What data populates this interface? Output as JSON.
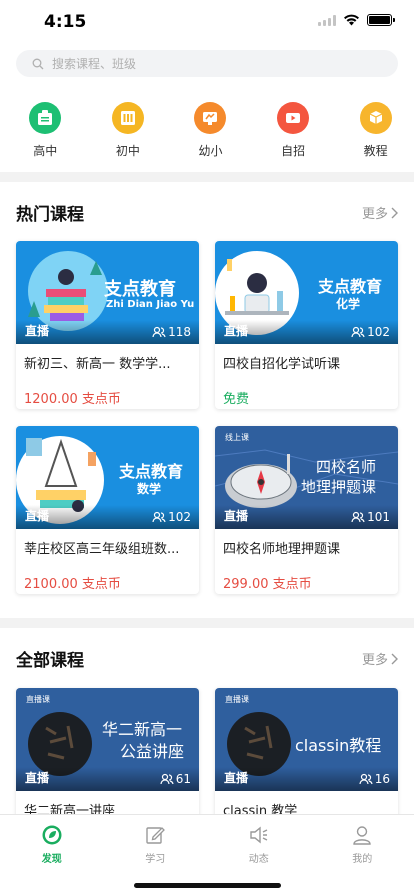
{
  "status": {
    "time": "4:15"
  },
  "search": {
    "placeholder": "搜索课程、班级"
  },
  "categories": [
    {
      "label": "高中",
      "icon": "high-school-icon",
      "color": "#1dbf73"
    },
    {
      "label": "初中",
      "icon": "middle-school-icon",
      "color": "#f5b623"
    },
    {
      "label": "幼小",
      "icon": "preschool-icon",
      "color": "#f58a2c"
    },
    {
      "label": "自招",
      "icon": "video-play-icon",
      "color": "#f4563f"
    },
    {
      "label": "教程",
      "icon": "cube-icon",
      "color": "#f7b52d"
    }
  ],
  "hot": {
    "title": "热门课程",
    "more": "更多",
    "courses": [
      {
        "title": "新初三、新高一 数学学...",
        "tag": "直播",
        "count": "118",
        "price": "1200.00 支点币",
        "free": false,
        "img_text": [
          "支点教育",
          "Zhi Dian Jiao Yu"
        ]
      },
      {
        "title": "四校自招化学试听课",
        "tag": "直播",
        "count": "102",
        "price": "免费",
        "free": true,
        "img_text": [
          "支点教育",
          "化学"
        ]
      },
      {
        "title": "莘庄校区高三年级组班数...",
        "tag": "直播",
        "count": "102",
        "price": "2100.00 支点币",
        "free": false,
        "img_text": [
          "支点教育",
          "数学"
        ]
      },
      {
        "title": "四校名师地理押题课",
        "tag": "直播",
        "count": "101",
        "price": "299.00 支点币",
        "free": false,
        "img_text": [
          "线上课",
          "四校名师",
          "地理押题课"
        ]
      }
    ]
  },
  "all": {
    "title": "全部课程",
    "more": "更多",
    "courses": [
      {
        "title": "华二新高一讲座",
        "tag": "直播",
        "count": "61",
        "img_text": [
          "直播课",
          "华二新高一",
          "公益讲座"
        ]
      },
      {
        "title": "classin 教学",
        "tag": "直播",
        "count": "16",
        "img_text": [
          "直播课",
          "classin教程"
        ]
      }
    ]
  },
  "tabbar": [
    {
      "label": "发现",
      "icon": "discover-icon",
      "active": true
    },
    {
      "label": "学习",
      "icon": "study-edit-icon",
      "active": false
    },
    {
      "label": "动态",
      "icon": "speaker-icon",
      "active": false
    },
    {
      "label": "我的",
      "icon": "profile-icon",
      "active": false
    }
  ],
  "colors": {
    "accent": "#1aad5f",
    "price": "#e54d42",
    "card_blue": "#1a8fe0"
  }
}
